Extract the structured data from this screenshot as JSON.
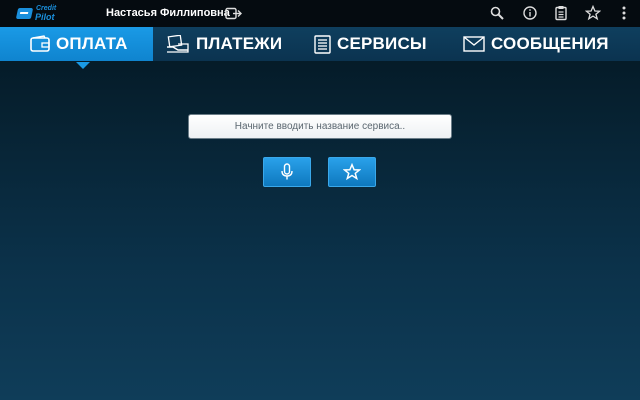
{
  "app": {
    "logo_line1": "Credit",
    "logo_line2": "Pilot"
  },
  "topbar": {
    "user_name": "Настасья Филлиповна",
    "icons": [
      "logout-icon",
      "search-icon",
      "info-icon",
      "clipboard-icon",
      "star-icon",
      "more-vertical-icon"
    ]
  },
  "tabs": [
    {
      "label": "ОПЛАТА",
      "icon": "wallet-icon",
      "active": true
    },
    {
      "label": "ПЛАТЕЖИ",
      "icon": "payments-icon",
      "active": false
    },
    {
      "label": "СЕРВИСЫ",
      "icon": "list-icon",
      "active": false
    },
    {
      "label": "СООБЩЕНИЯ",
      "icon": "envelope-icon",
      "active": false
    }
  ],
  "search": {
    "placeholder": "Начните вводить название сервиса..",
    "value": ""
  },
  "actions": {
    "buttons": [
      "microphone-icon",
      "star-icon"
    ]
  },
  "colors": {
    "accent": "#1a9ae6",
    "topbar_bg": "#050b10",
    "tabbar_bg": "#0f3f5e"
  }
}
